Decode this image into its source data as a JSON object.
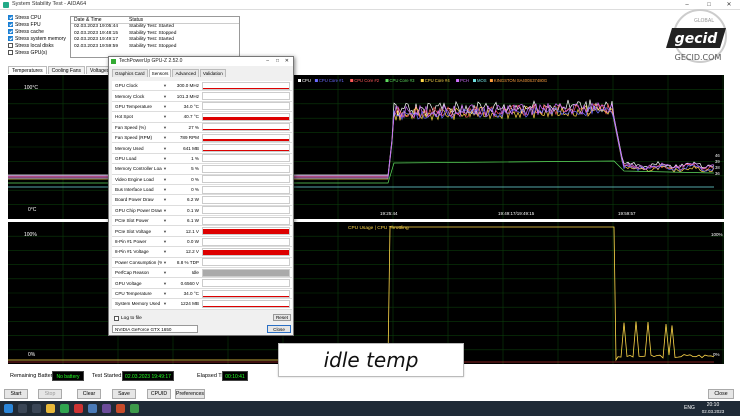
{
  "window": {
    "title": "System Stability Test - AIDA64"
  },
  "stress_options": [
    {
      "label": "Stress CPU",
      "checked": true
    },
    {
      "label": "Stress FPU",
      "checked": true
    },
    {
      "label": "Stress cache",
      "checked": true
    },
    {
      "label": "Stress system memory",
      "checked": true
    },
    {
      "label": "Stress local disks",
      "checked": false
    },
    {
      "label": "Stress GPU(s)",
      "checked": false
    }
  ],
  "log": {
    "col_date": "Date & Time",
    "col_status": "Status",
    "rows": [
      {
        "date": "02.03.2023 19:05:44",
        "status": "Stability Test: Started"
      },
      {
        "date": "02.03.2023 19:48:15",
        "status": "Stability Test: Stopped"
      },
      {
        "date": "02.03.2023 19:49:17",
        "status": "Stability Test: Started"
      },
      {
        "date": "02.03.2023 19:59:59",
        "status": "Stability Test: Stopped"
      }
    ]
  },
  "tabs": [
    "Temperatures",
    "Cooling Fans",
    "Voltages",
    "Powers"
  ],
  "temp_graph": {
    "y_top": "100°C",
    "y_bottom": "0°C",
    "times": [
      "19:25:44",
      "19:49:17/19:49:15",
      "19:59:57"
    ],
    "legend": [
      "CPU",
      "CPU Core #1",
      "CPU Core #2",
      "CPU Core #3",
      "CPU Core #4",
      "PCH",
      "MOS",
      "KINGSTON SA400S37480G"
    ],
    "legend_colors": [
      "#ffffff",
      "#6a6aff",
      "#ff5a5a",
      "#5fdc5f",
      "#ffd84a",
      "#d070ff",
      "#70e0e0",
      "#ffa040"
    ],
    "right_vals": [
      "46",
      "39",
      "38",
      "36"
    ]
  },
  "usage_graph": {
    "title": "CPU Usage | CPU Throttling",
    "y_top": "100%",
    "y_bottom": "0%",
    "right_top": "100%",
    "right_bottom": "0%"
  },
  "bottom": {
    "battery_label": "Remaining Battery:",
    "battery_value": "No battery",
    "started_label": "Test Started:",
    "started_value": "02.03.2023 19:49:17",
    "elapsed_label": "Elapsed Time:",
    "elapsed_value": "00:10:41"
  },
  "buttons": {
    "start": "Start",
    "stop": "Stop",
    "clear": "Clear",
    "save": "Save",
    "cpuid": "CPUID",
    "preferences": "Preferences",
    "close": "Close"
  },
  "gpuz": {
    "title": "TechPowerUp GPU-Z 2.52.0",
    "tabs": [
      "Graphics Card",
      "Sensors",
      "Advanced",
      "Validation"
    ],
    "sensors": [
      {
        "name": "GPU Clock",
        "value": "300.0 MHz",
        "level": 0.05,
        "color": "#d00"
      },
      {
        "name": "Memory Clock",
        "value": "101.3 MHz",
        "level": 0.05,
        "color": "#d00"
      },
      {
        "name": "GPU Temperature",
        "value": "34.0 °C",
        "level": 0.15,
        "color": "#d00"
      },
      {
        "name": "Hot Spot",
        "value": "40.7 °C",
        "level": 0.4,
        "color": "#d00"
      },
      {
        "name": "Fan Speed (%)",
        "value": "27 %",
        "level": 0.25,
        "color": "#d00"
      },
      {
        "name": "Fan Speed (RPM)",
        "value": "789 RPM",
        "level": 0.3,
        "color": "#d00"
      },
      {
        "name": "Memory Used",
        "value": "641 MB",
        "level": 0.12,
        "color": "#d00"
      },
      {
        "name": "GPU Load",
        "value": "1 %",
        "level": 0.0,
        "color": "#d00"
      },
      {
        "name": "Memory Controller Load",
        "value": "5 %",
        "level": 0.0,
        "color": "#d00"
      },
      {
        "name": "Video Engine Load",
        "value": "0 %",
        "level": 0.0,
        "color": "#d00"
      },
      {
        "name": "Bus Interface Load",
        "value": "0 %",
        "level": 0.0,
        "color": "#d00"
      },
      {
        "name": "Board Power Draw",
        "value": "6.2 W",
        "level": 0.0,
        "color": "#d00"
      },
      {
        "name": "GPU Chip Power Draw",
        "value": "0.1 W",
        "level": 0.0,
        "color": "#d00"
      },
      {
        "name": "PCIe Slot Power",
        "value": "6.1 W",
        "level": 0.0,
        "color": "#d00"
      },
      {
        "name": "PCIe Slot Voltage",
        "value": "12.1 V",
        "level": 0.9,
        "color": "#d00"
      },
      {
        "name": "8-Pin #1 Power",
        "value": "0.0 W",
        "level": 0.0,
        "color": "#d00"
      },
      {
        "name": "8-Pin #1 Voltage",
        "value": "12.2 V",
        "level": 0.9,
        "color": "#d00"
      },
      {
        "name": "Power Consumption (%)",
        "value": "8.8 % TDP",
        "level": 0.0,
        "color": "#d00"
      },
      {
        "name": "PerfCap Reason",
        "value": "Idle",
        "level": 1.0,
        "color": "#aaa"
      },
      {
        "name": "GPU Voltage",
        "value": "0.6560 V",
        "level": 0.0,
        "color": "#d00"
      },
      {
        "name": "CPU Temperature",
        "value": "34.0 °C",
        "level": 0.15,
        "color": "#d00"
      },
      {
        "name": "System Memory Used",
        "value": "1224 MB",
        "level": 0.1,
        "color": "#d00"
      }
    ],
    "log_label": "Log to file",
    "reset": "Reset",
    "gpu_name": "NVIDIA GeForce GTX 1650",
    "close": "Close"
  },
  "caption": "idle temp",
  "logo": {
    "top": "GLOBAL",
    "mid": "gecid",
    "site": "GECID.COM"
  },
  "taskbar": {
    "time": "20:10",
    "date": "02.03.2023",
    "lang": "ENG"
  }
}
